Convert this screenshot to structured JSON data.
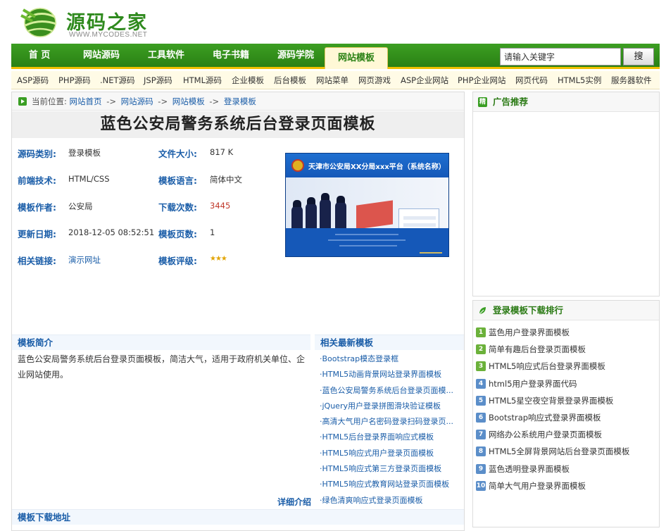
{
  "logo": {
    "title": "源码之家",
    "subtitle": "WWW.MYCODES.NET"
  },
  "nav": {
    "items": [
      {
        "label": "首 页"
      },
      {
        "label": "网站源码"
      },
      {
        "label": "工具软件"
      },
      {
        "label": "电子书籍"
      },
      {
        "label": "源码学院"
      },
      {
        "label": "网站模板"
      }
    ],
    "active": "网站模板",
    "search_placeholder": "请输入关键字",
    "search_button": "搜"
  },
  "subnav": {
    "items": [
      {
        "label": "ASP源码"
      },
      {
        "label": "PHP源码"
      },
      {
        "label": ".NET源码"
      },
      {
        "label": "JSP源码"
      },
      {
        "label": "HTML源码"
      },
      {
        "label": "企业模板"
      },
      {
        "label": "后台模板"
      },
      {
        "label": "网站菜单"
      },
      {
        "label": "网页游戏"
      },
      {
        "label": "ASP企业网站"
      },
      {
        "label": "PHP企业网站"
      },
      {
        "label": "网页代码"
      },
      {
        "label": "HTML5实例"
      },
      {
        "label": "服务器软件"
      }
    ]
  },
  "breadcrumb": {
    "prefix": "当前位置:",
    "items": [
      "网站首页",
      "网站源码",
      "网站模板",
      "登录模板"
    ],
    "separator": "->"
  },
  "page": {
    "title": "蓝色公安局警务系统后台登录页面模板"
  },
  "info": {
    "category_label": "源码类别:",
    "category_value": "登录模板",
    "size_label": "文件大小:",
    "size_value": "817 K",
    "tech_label": "前端技术:",
    "tech_value": "HTML/CSS",
    "lang_label": "模板语言:",
    "lang_value": "简体中文",
    "author_label": "模板作者:",
    "author_value": "公安局",
    "downloads_label": "下载次数:",
    "downloads_value": "3445",
    "updated_label": "更新日期:",
    "updated_value": "2018-12-05 08:52:51",
    "pages_label": "模板页数:",
    "pages_value": "1",
    "link_label": "相关链接:",
    "link_value": "演示网址",
    "rating_label": "模板评级:",
    "rating_stars": 3,
    "rating_glyph": "★★★"
  },
  "preview": {
    "title": "天津市公安局XX分局xxx平台（系统名称）",
    "colors": {
      "primary": "#1558b8",
      "flag": "#d93a2f"
    }
  },
  "intro": {
    "heading": "模板简介",
    "text": "蓝色公安局警务系统后台登录页面模板，简洁大气，适用于政府机关单位、企业网站使用。",
    "detail_link": "详细介绍"
  },
  "related": {
    "heading": "相关最新模板",
    "items": [
      "·Bootstrap模态登录框",
      "·HTML5动画背景网站登录界面模板",
      "·蓝色公安局警务系统后台登录页面模...",
      "·jQuery用户登录拼图滑块验证模板",
      "·高清大气用户名密码登录扫码登录页...",
      "·HTML5后台登录界面响应式模板",
      "·HTML5响应式用户登录页面模板",
      "·HTML5响应式第三方登录页面模板",
      "·HTML5响应式教育网站登录页面模板",
      "·绿色清爽响应式登录页面模板"
    ]
  },
  "download": {
    "heading": "模板下载地址"
  },
  "sidebar": {
    "ad_heading": "广告推荐",
    "ad_icon": "精",
    "rank_heading": "登录模板下载排行",
    "rank_items": [
      {
        "num": "1",
        "label": "蓝色用户登录界面模板"
      },
      {
        "num": "2",
        "label": "简单有趣后台登录页面模板"
      },
      {
        "num": "3",
        "label": "HTML5响应式后台登录界面模板"
      },
      {
        "num": "4",
        "label": "html5用户登录界面代码"
      },
      {
        "num": "5",
        "label": "HTML5星空夜空背景登录界面模板"
      },
      {
        "num": "6",
        "label": "Bootstrap响应式登录界面模板"
      },
      {
        "num": "7",
        "label": "网络办公系统用户登录页面模板"
      },
      {
        "num": "8",
        "label": "HTML5全屏背景网站后台登录页面模板"
      },
      {
        "num": "9",
        "label": "蓝色透明登录界面模板"
      },
      {
        "num": "10",
        "label": "简单大气用户登录界面模板"
      }
    ]
  }
}
